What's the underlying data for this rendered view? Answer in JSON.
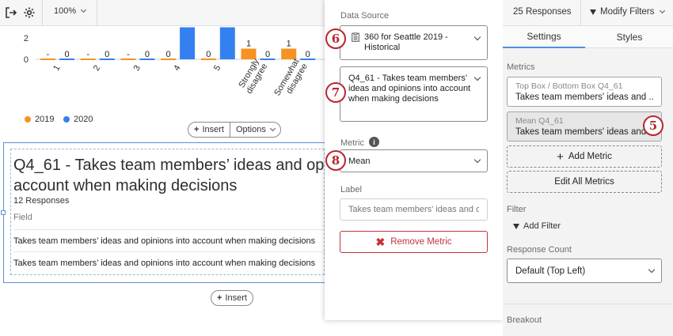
{
  "toolbar": {
    "zoom": "100%",
    "responses": "25 Responses",
    "modify_filters": "Modify Filters"
  },
  "chart_data": {
    "type": "bar",
    "categories": [
      "1",
      "2",
      "3",
      "4",
      "5",
      "Strongly disagree",
      "Somewhat disagree"
    ],
    "series": [
      {
        "name": "2019",
        "color": "#f59222",
        "values": [
          0,
          0,
          0,
          0,
          0,
          1,
          1
        ],
        "labels": [
          "-",
          "-",
          "-",
          "0",
          "0",
          "1",
          "1"
        ]
      },
      {
        "name": "2020",
        "color": "#3480f0",
        "values": [
          0,
          0,
          0,
          3,
          3,
          0,
          0
        ],
        "labels": [
          "0",
          "0",
          "0",
          "",
          "",
          "0",
          "0"
        ]
      }
    ],
    "yticks": [
      "2",
      "0"
    ],
    "ylim": [
      0,
      3.5
    ]
  },
  "legend": [
    {
      "label": "2019",
      "color": "#f59222"
    },
    {
      "label": "2020",
      "color": "#3480f0"
    }
  ],
  "chart_actions": {
    "insert": "Insert",
    "options": "Options"
  },
  "widget": {
    "title_line1": "Q4_61 - Takes team members’ ideas and op",
    "title_line2": "account when making decisions",
    "responses": "12 Responses",
    "field_header": "Field",
    "rows": [
      "Takes team members’ ideas and opinions into account when making decisions",
      "Takes team members’ ideas and opinions into account when making decisions"
    ]
  },
  "bottom_insert": "Insert",
  "editor": {
    "data_source_label": "Data Source",
    "data_source_value": "360 for Seattle 2019 - Historical",
    "question_value": "Q4_61 - Takes team members’ ideas and opinions into account when making decisions",
    "metric_label": "Metric",
    "metric_value": "Mean",
    "label_label": "Label",
    "label_placeholder": "Takes team members' ideas and o",
    "remove_metric": "Remove Metric"
  },
  "badges": {
    "b5": "5",
    "b6": "6",
    "b7": "7",
    "b8": "8"
  },
  "sidebar": {
    "tab_settings": "Settings",
    "tab_styles": "Styles",
    "metrics_label": "Metrics",
    "metric1_key": "Top Box / Bottom Box Q4_61",
    "metric1_value": "Takes team members' ideas and ...",
    "metric2_key": "Mean Q4_61",
    "metric2_value": "Takes team members' ideas and ...",
    "add_metric": "Add Metric",
    "edit_all_metrics": "Edit All Metrics",
    "filter_label": "Filter",
    "add_filter": "Add Filter",
    "response_count_label": "Response Count",
    "response_count_value": "Default (Top Left)",
    "breakout_label": "Breakout"
  },
  "colors": {
    "accent_red": "#b7272d",
    "selection_blue": "#5d8fd1"
  }
}
